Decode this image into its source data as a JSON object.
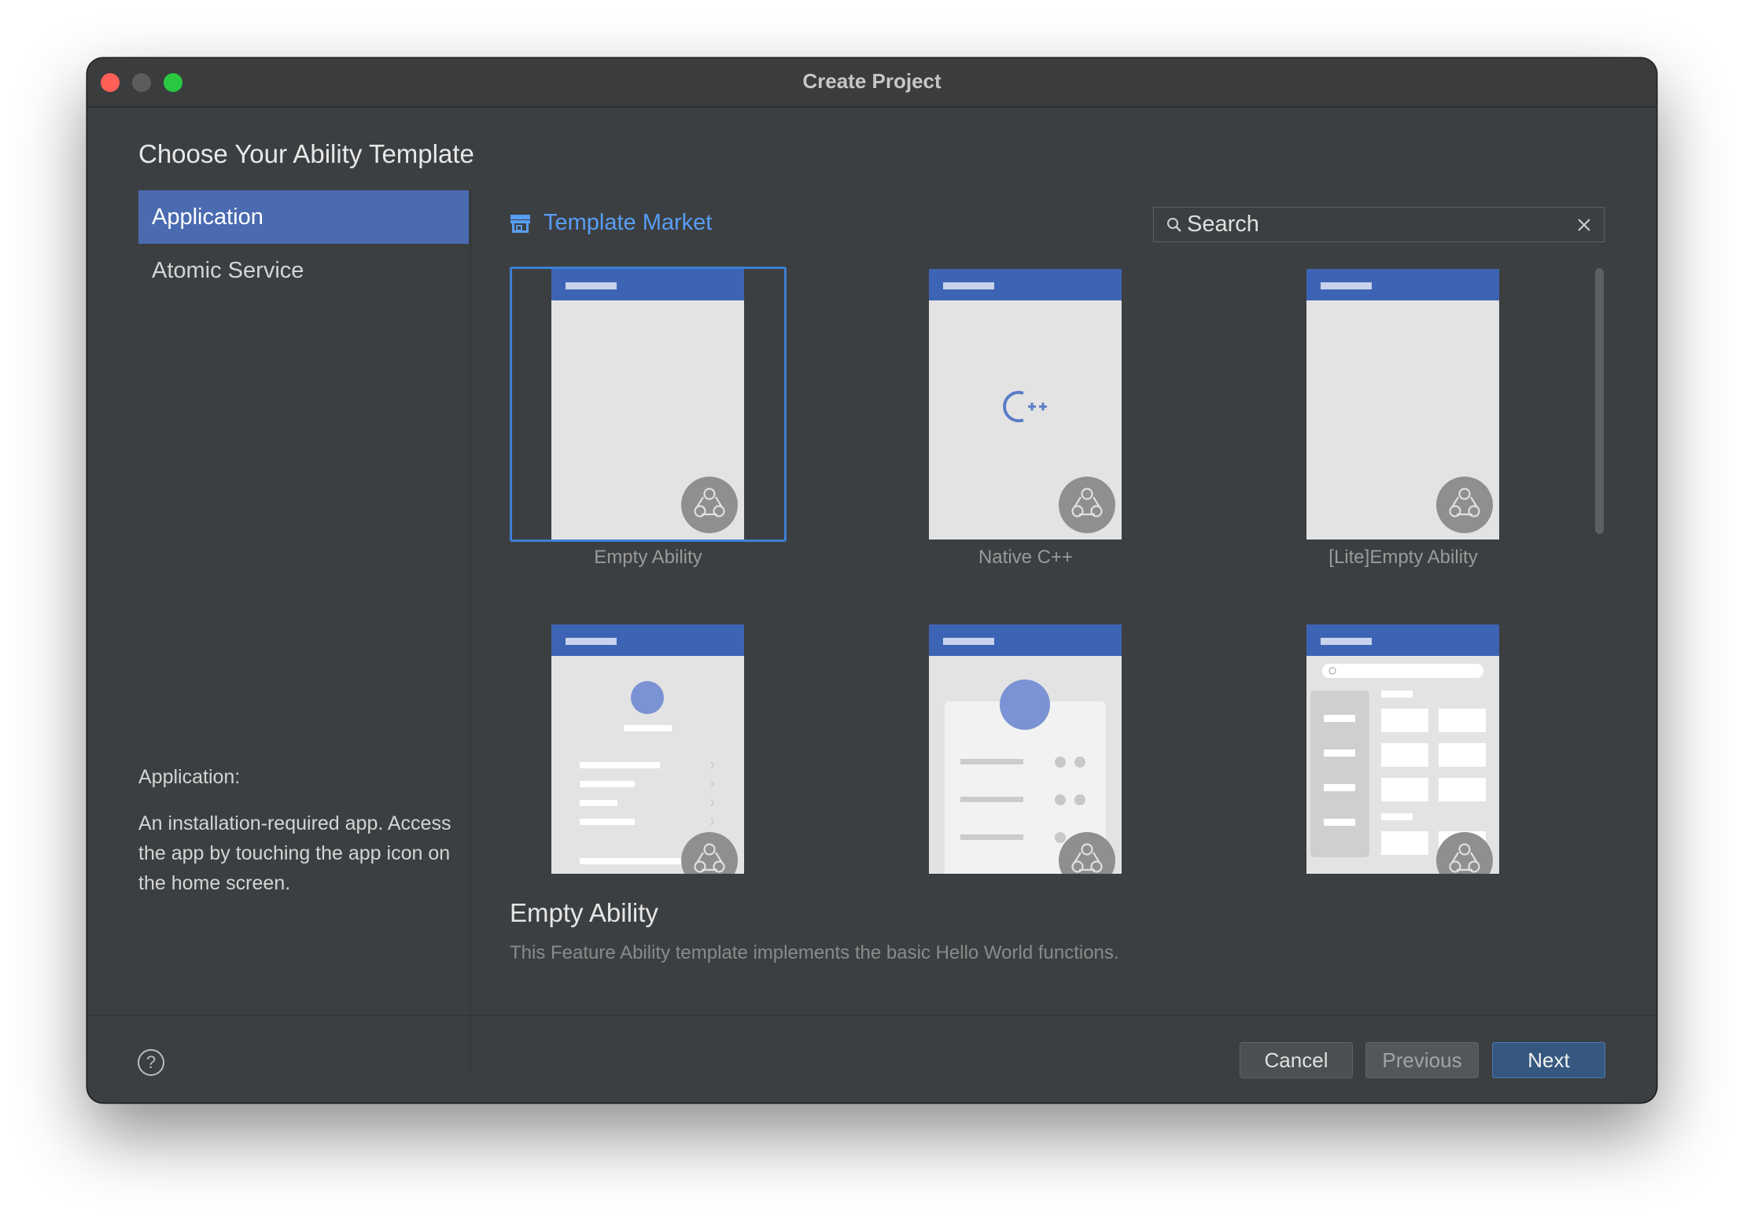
{
  "window": {
    "title": "Create Project"
  },
  "heading": "Choose Your Ability Template",
  "nav": {
    "items": [
      {
        "label": "Application",
        "active": true
      },
      {
        "label": "Atomic Service",
        "active": false
      }
    ]
  },
  "description": {
    "title": "Application:",
    "text": "An installation-required app. Access the app by touching the app icon on the home screen."
  },
  "market": {
    "label": "Template Market",
    "icon": "store-icon"
  },
  "search": {
    "placeholder": "Search",
    "value": ""
  },
  "templates": [
    {
      "name": "Empty Ability",
      "selected": true,
      "preview": "empty"
    },
    {
      "name": "Native C++",
      "selected": false,
      "preview": "cpp",
      "preview_text": "C++"
    },
    {
      "name": "[Lite]Empty Ability",
      "selected": false,
      "preview": "empty"
    },
    {
      "name": "",
      "selected": false,
      "preview": "profile-list"
    },
    {
      "name": "",
      "selected": false,
      "preview": "card-list"
    },
    {
      "name": "",
      "selected": false,
      "preview": "sidebar-grid"
    }
  ],
  "selected_template": {
    "title": "Empty Ability",
    "description": "This Feature Ability template implements the basic Hello World functions."
  },
  "buttons": {
    "help": "?",
    "cancel": "Cancel",
    "previous": "Previous",
    "next": "Next"
  },
  "colors": {
    "accent": "#589df6",
    "nav_active": "#4a6bb0",
    "phone_bar": "#3d64b4",
    "next_button": "#365880"
  }
}
